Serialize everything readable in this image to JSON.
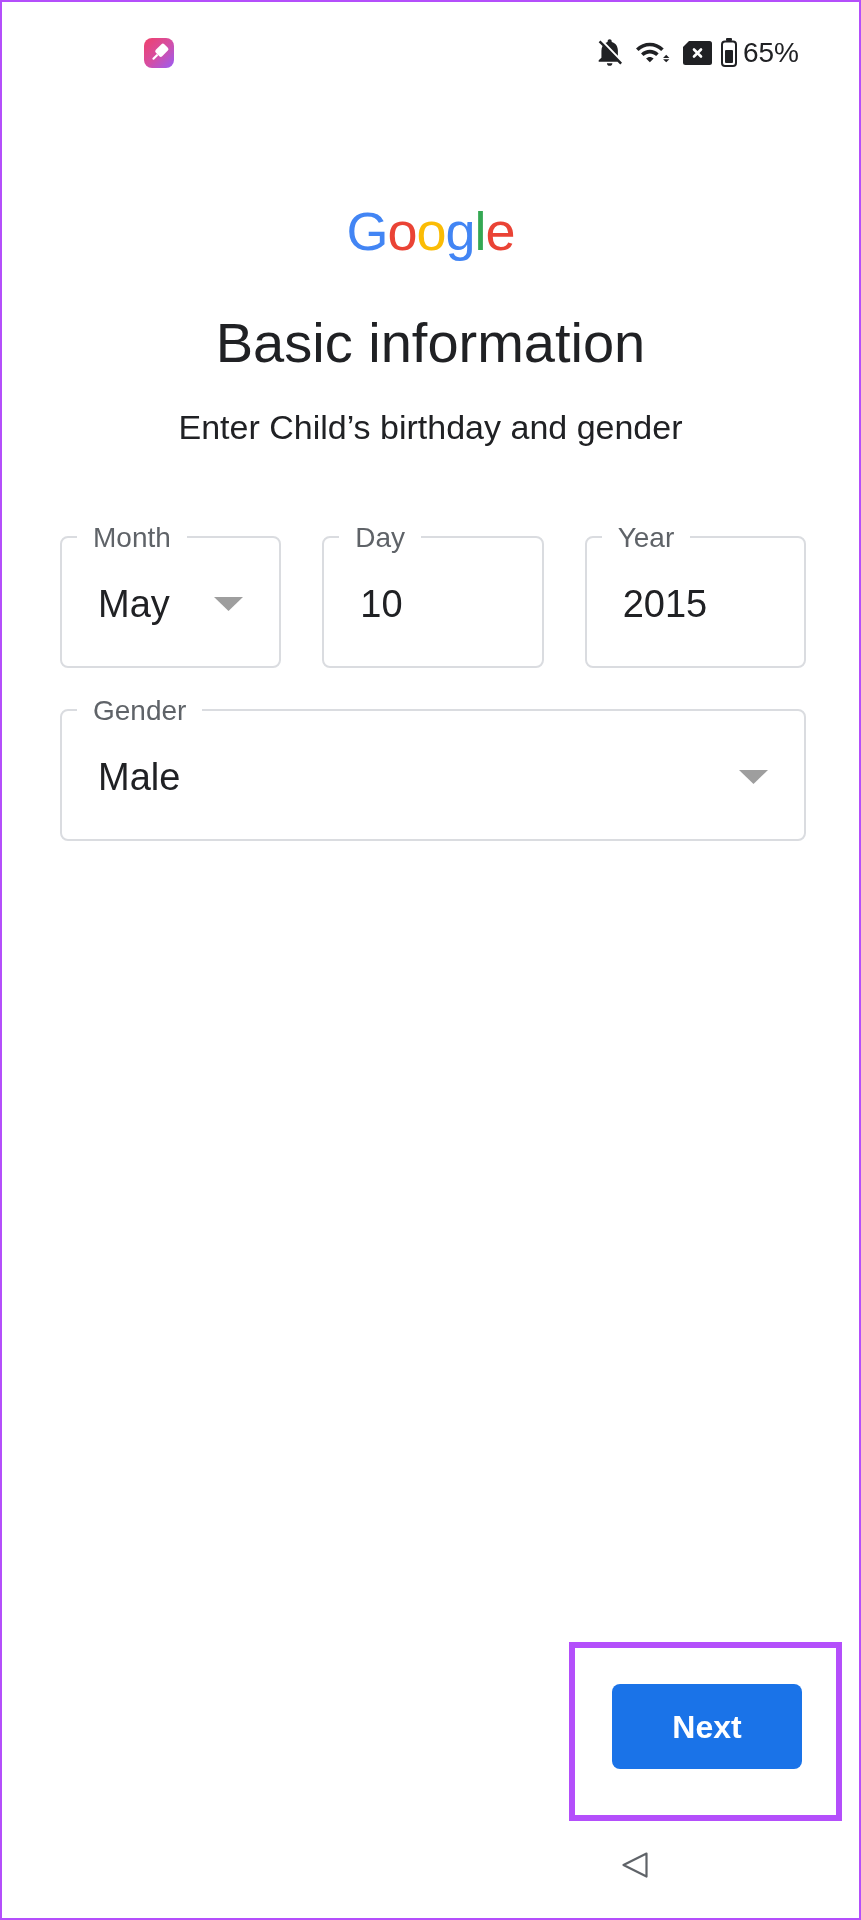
{
  "status_bar": {
    "battery": "65%"
  },
  "logo": "Google",
  "title": "Basic information",
  "subtitle": "Enter Child’s birthday and gender",
  "birthday_fields": [
    {
      "kind": "dropdown",
      "label": "Month",
      "value": "May"
    },
    {
      "kind": "text",
      "label": "Day",
      "value": "10"
    },
    {
      "kind": "text",
      "label": "Year",
      "value": "2015"
    }
  ],
  "gender_field": {
    "kind": "dropdown",
    "label": "Gender",
    "value": "Male"
  },
  "next_button": {
    "label": "Next",
    "highlighted": true
  }
}
